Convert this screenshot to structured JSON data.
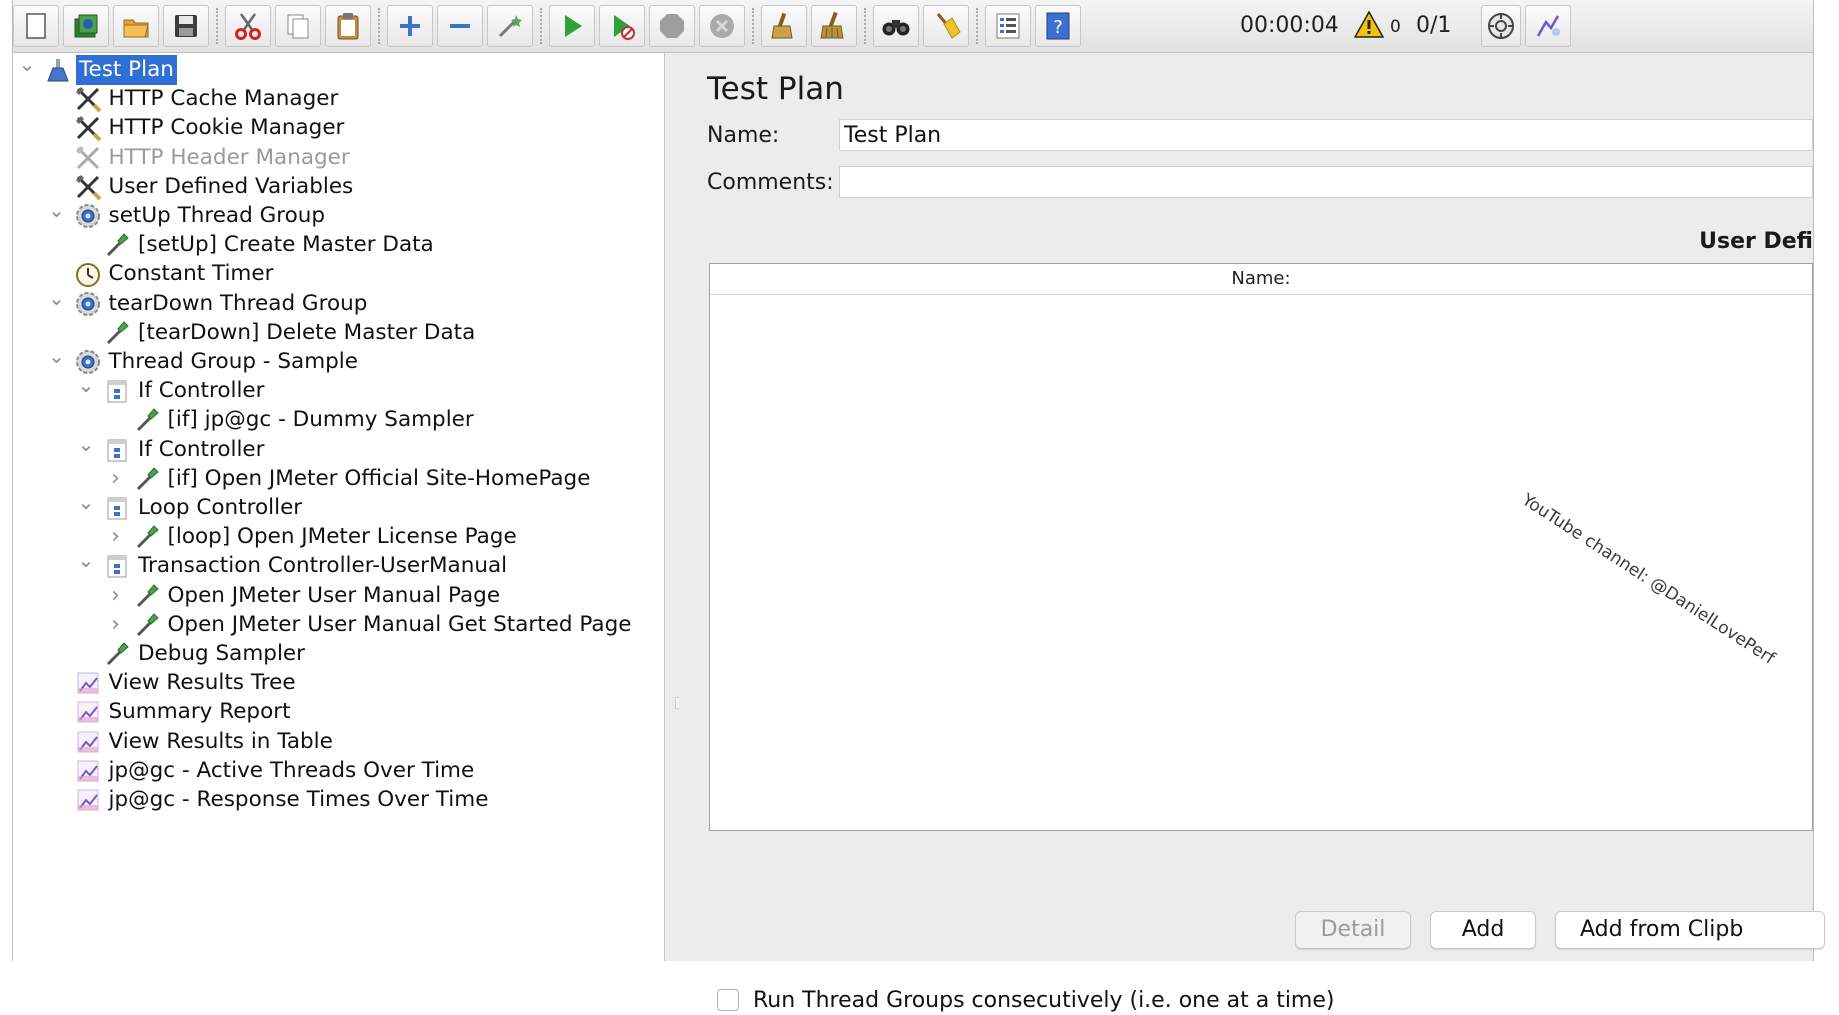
{
  "toolbar": {
    "elapsed_time": "00:00:04",
    "warning_count": "0",
    "threads": "0/1",
    "buttons": [
      "new",
      "templates",
      "open",
      "save",
      "cut",
      "copy",
      "paste",
      "expand-all",
      "collapse-all",
      "toggle",
      "start",
      "start-no-pauses",
      "stop",
      "shutdown",
      "clear",
      "clear-all",
      "search",
      "reset-search",
      "function-helper",
      "help"
    ]
  },
  "tree": {
    "items": [
      {
        "label": "Test Plan",
        "icon": "test-plan-icon",
        "toggle": "down",
        "selected": true
      },
      {
        "label": "HTTP Cache Manager",
        "icon": "config-element-icon"
      },
      {
        "label": "HTTP Cookie Manager",
        "icon": "config-element-icon"
      },
      {
        "label": "HTTP Header Manager",
        "icon": "config-element-icon",
        "disabled": true
      },
      {
        "label": "User Defined Variables",
        "icon": "config-element-icon"
      },
      {
        "label": "setUp Thread Group",
        "icon": "thread-group-icon",
        "toggle": "down"
      },
      {
        "label": "[setUp] Create Master Data",
        "icon": "sampler-icon"
      },
      {
        "label": "Constant Timer",
        "icon": "timer-icon"
      },
      {
        "label": "tearDown Thread Group",
        "icon": "thread-group-icon",
        "toggle": "down"
      },
      {
        "label": "[tearDown] Delete Master Data",
        "icon": "sampler-icon"
      },
      {
        "label": "Thread Group - Sample",
        "icon": "thread-group-icon",
        "toggle": "down"
      },
      {
        "label": "If Controller",
        "icon": "controller-icon",
        "toggle": "down"
      },
      {
        "label": "[if] jp@gc - Dummy Sampler",
        "icon": "sampler-icon"
      },
      {
        "label": "If Controller",
        "icon": "controller-icon",
        "toggle": "down"
      },
      {
        "label": "[if] Open JMeter Official Site-HomePage",
        "icon": "sampler-icon",
        "toggle": "right"
      },
      {
        "label": "Loop Controller",
        "icon": "controller-icon",
        "toggle": "down"
      },
      {
        "label": "[loop] Open JMeter License Page",
        "icon": "sampler-icon",
        "toggle": "right"
      },
      {
        "label": "Transaction Controller-UserManual",
        "icon": "controller-icon",
        "toggle": "down"
      },
      {
        "label": "Open JMeter User Manual Page",
        "icon": "sampler-icon",
        "toggle": "right"
      },
      {
        "label": "Open JMeter User Manual Get Started Page",
        "icon": "sampler-icon",
        "toggle": "right"
      },
      {
        "label": "Debug Sampler",
        "icon": "sampler-icon"
      },
      {
        "label": "View Results Tree",
        "icon": "listener-icon"
      },
      {
        "label": "Summary Report",
        "icon": "listener-icon"
      },
      {
        "label": "View Results in Table",
        "icon": "listener-icon"
      },
      {
        "label": "jp@gc - Active Threads Over Time",
        "icon": "listener-icon"
      },
      {
        "label": "jp@gc - Response Times Over Time",
        "icon": "listener-icon"
      }
    ]
  },
  "editor": {
    "title": "Test Plan",
    "name_label": "Name:",
    "name_value": "Test Plan",
    "comments_label": "Comments:",
    "comments_value": "",
    "udv_title": "User Defi",
    "table_header_name": "Name:",
    "detail_button": "Detail",
    "add_button": "Add",
    "add_from_clipboard_button": "Add from Clipb",
    "run_consecutively_label": "Run Thread Groups consecutively (i.e. one at a time)",
    "run_consecutively_checked": false
  },
  "watermark": "YouTube channel: @DanielLovePerf",
  "colors": {
    "selection": "#2f6fd6",
    "panel_background": "#ececec",
    "tree_background": "#ffffff"
  }
}
